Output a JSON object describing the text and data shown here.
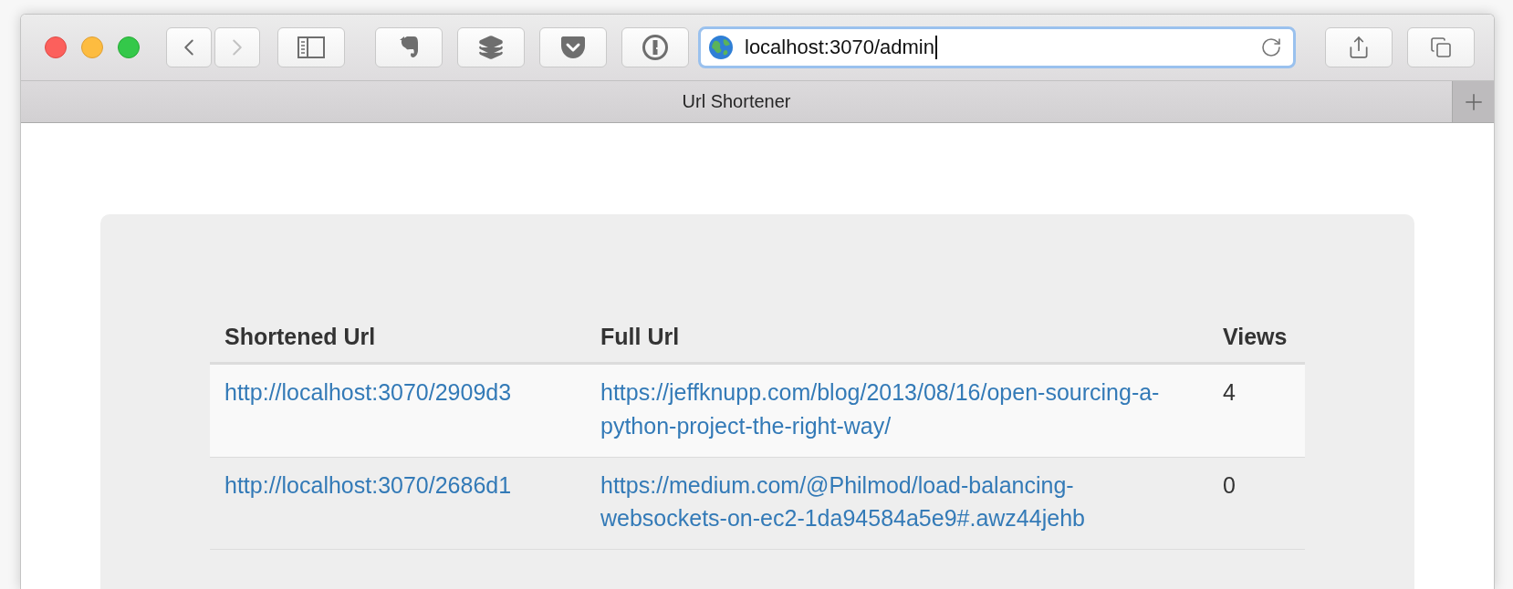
{
  "browser": {
    "address": "localhost:3070/admin",
    "tab_title": "Url Shortener",
    "back_disabled": false,
    "forward_disabled": true
  },
  "table": {
    "columns": [
      "Shortened Url",
      "Full Url",
      "Views"
    ],
    "rows": [
      {
        "shortened_url": "http://localhost:3070/2909d3",
        "full_url": "https://jeffknupp.com/blog/2013/08/16/open-sourcing-a-python-project-the-right-way/",
        "views": "4"
      },
      {
        "shortened_url": "http://localhost:3070/2686d1",
        "full_url": "https://medium.com/@Philmod/load-balancing-websockets-on-ec2-1da94584a5e9#.awz44jehb",
        "views": "0"
      }
    ]
  }
}
